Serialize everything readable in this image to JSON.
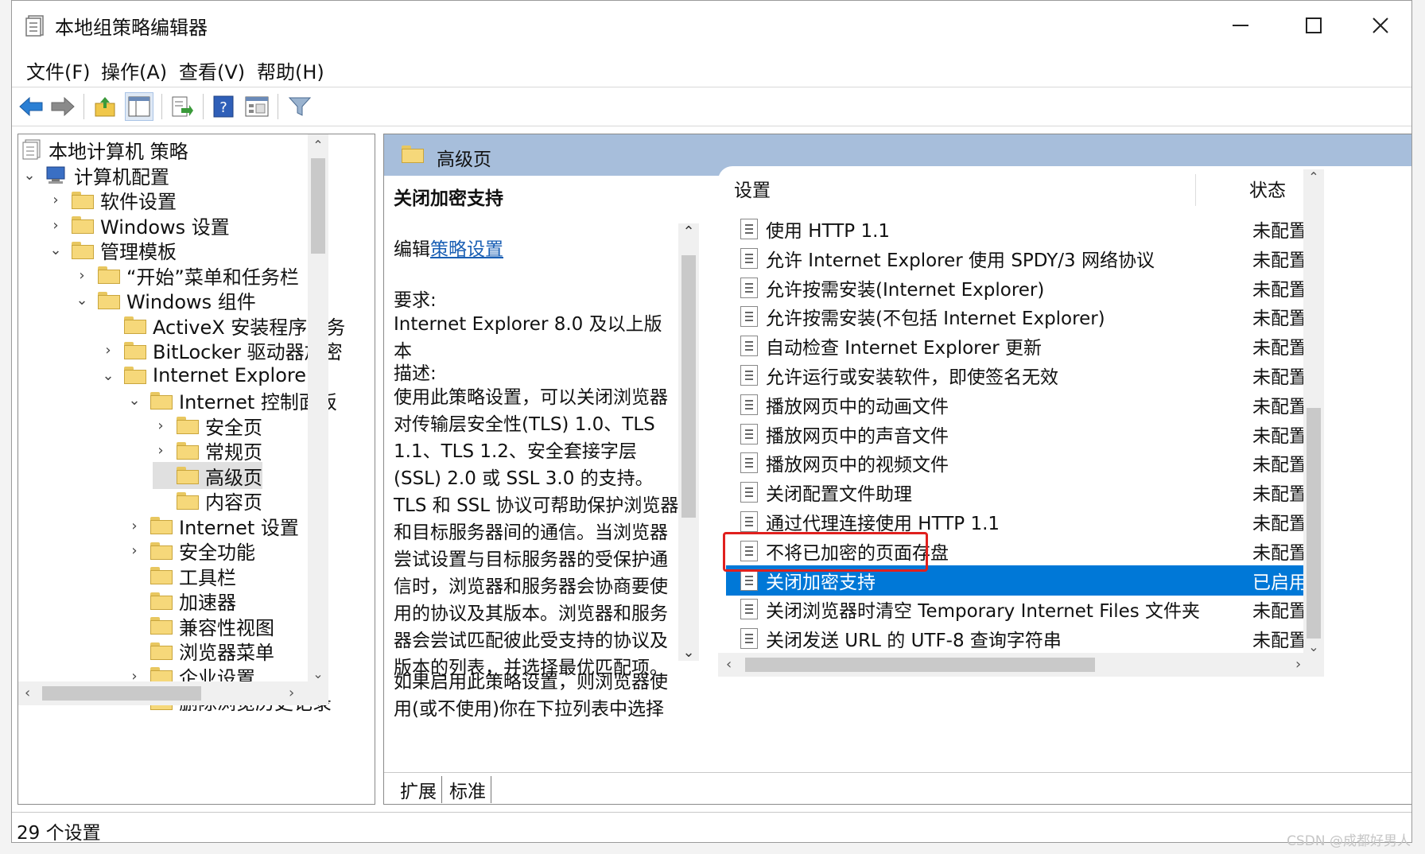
{
  "window": {
    "title": "本地组策略编辑器"
  },
  "menu": [
    "文件(F)",
    "操作(A)",
    "查看(V)",
    "帮助(H)"
  ],
  "tree": {
    "root": "本地计算机 策略",
    "items": [
      {
        "label": "计算机配置",
        "arrow": "⌄"
      },
      {
        "label": "软件设置",
        "arrow": "›"
      },
      {
        "label": "Windows 设置",
        "arrow": "›"
      },
      {
        "label": "管理模板",
        "arrow": "⌄"
      },
      {
        "label": "“开始”菜单和任务栏",
        "arrow": "›"
      },
      {
        "label": "Windows 组件",
        "arrow": "⌄"
      },
      {
        "label": "ActiveX 安装程序服务",
        "arrow": ""
      },
      {
        "label": "BitLocker 驱动器加密",
        "arrow": "›"
      },
      {
        "label": "Internet Explorer",
        "arrow": "⌄"
      },
      {
        "label": "Internet 控制面板",
        "arrow": "⌄"
      },
      {
        "label": "安全页",
        "arrow": "›"
      },
      {
        "label": "常规页",
        "arrow": "›"
      },
      {
        "label": "高级页",
        "arrow": ""
      },
      {
        "label": "内容页",
        "arrow": ""
      },
      {
        "label": "Internet 设置",
        "arrow": "›"
      },
      {
        "label": "安全功能",
        "arrow": "›"
      },
      {
        "label": "工具栏",
        "arrow": ""
      },
      {
        "label": "加速器",
        "arrow": ""
      },
      {
        "label": "兼容性视图",
        "arrow": ""
      },
      {
        "label": "浏览器菜单",
        "arrow": ""
      },
      {
        "label": "企业设置",
        "arrow": "›"
      },
      {
        "label": "删除浏览历史记录",
        "arrow": ""
      }
    ]
  },
  "header": {
    "folder_title": "高级页"
  },
  "description": {
    "policy_title": "关闭加密支持",
    "edit_prefix": "编辑",
    "edit_link": "策略设置",
    "requirements_label": "要求:",
    "requirements_value": "Internet Explorer 8.0 及以上版本",
    "desc_label": "描述:",
    "desc_body": "使用此策略设置，可以关闭浏览器对传输层安全性(TLS) 1.0、TLS 1.1、TLS 1.2、安全套接字层(SSL) 2.0 或 SSL 3.0 的支持。TLS 和 SSL 协议可帮助保护浏览器和目标服务器间的通信。当浏览器尝试设置与目标服务器的受保护通信时，浏览器和服务器会协商要使用的协议及其版本。浏览器和服务器会尝试匹配彼此受支持的协议及版本的列表，并选择最优匹配项。",
    "desc_more": "如果启用此策略设置，则浏览器使用(或不使用)你在下拉列表中选择"
  },
  "list": {
    "col_setting": "设置",
    "col_state": "状态",
    "rows": [
      {
        "name": "使用 HTTP 1.1",
        "state": "未配置"
      },
      {
        "name": "允许 Internet Explorer 使用 SPDY/3 网络协议",
        "state": "未配置"
      },
      {
        "name": "允许按需安装(Internet Explorer)",
        "state": "未配置"
      },
      {
        "name": "允许按需安装(不包括 Internet Explorer)",
        "state": "未配置"
      },
      {
        "name": "自动检查 Internet Explorer 更新",
        "state": "未配置"
      },
      {
        "name": "允许运行或安装软件，即使签名无效",
        "state": "未配置"
      },
      {
        "name": "播放网页中的动画文件",
        "state": "未配置"
      },
      {
        "name": "播放网页中的声音文件",
        "state": "未配置"
      },
      {
        "name": "播放网页中的视频文件",
        "state": "未配置"
      },
      {
        "name": "关闭配置文件助理",
        "state": "未配置"
      },
      {
        "name": "通过代理连接使用 HTTP 1.1",
        "state": "未配置"
      },
      {
        "name": "不将已加密的页面存盘",
        "state": "未配置"
      },
      {
        "name": "关闭加密支持",
        "state": "已启用",
        "selected": true
      },
      {
        "name": "关闭浏览器时清空 Temporary Internet Files 文件夹",
        "state": "未配置"
      },
      {
        "name": "关闭发送 URL 的 UTF-8 查询字符串",
        "state": "未配置"
      }
    ]
  },
  "tabs": [
    "扩展",
    "标准"
  ],
  "status": {
    "text": "29 个设置"
  },
  "watermark": "CSDN @成都好男人",
  "colors": {
    "selection": "#0078d7",
    "header_band": "#a7bedb",
    "highlight_box": "#e0201e"
  }
}
